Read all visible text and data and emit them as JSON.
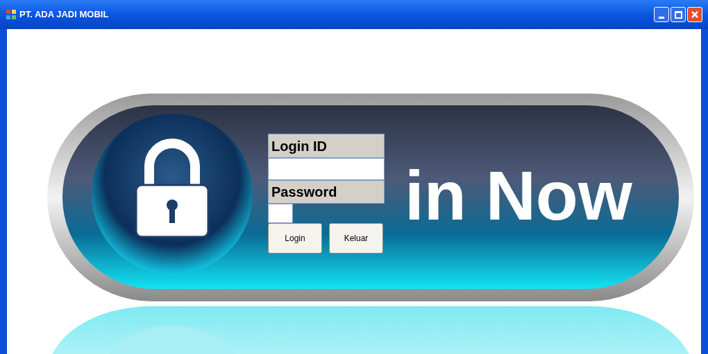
{
  "window": {
    "title": "PT. ADA JADI MOBIL"
  },
  "banner": {
    "text": "in Now"
  },
  "form": {
    "fields": [
      {
        "label": "Login ID"
      },
      {
        "label": "Password"
      }
    ],
    "buttons": [
      "Login",
      "Keluar"
    ]
  }
}
